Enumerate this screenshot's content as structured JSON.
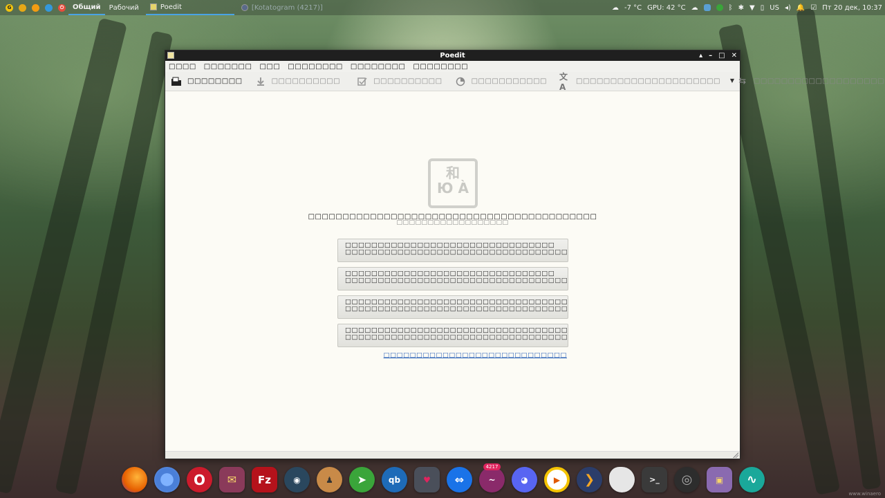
{
  "top_panel": {
    "workspace_1": "Общий",
    "workspace_2": "Рабочий",
    "tasks": [
      {
        "label": "Poedit",
        "active": true
      },
      {
        "label": "[Kotatogram (4217)]",
        "active": false
      }
    ],
    "weather": "-7 °C",
    "gpu": "GPU: 42 °C",
    "keyboard_layout": "US",
    "clock": "Пт 20 дек, 10:37"
  },
  "window": {
    "title": "Poedit",
    "controls": [
      "▴",
      "–",
      "□",
      "✕"
    ],
    "menu": [
      "□□□□",
      "□□□□□□□",
      "□□□",
      "□□□□□□□□",
      "□□□□□□□□",
      "□□□□□□□□"
    ],
    "toolbar": [
      {
        "label": "□□□□□□□□",
        "icon": "open-file-icon",
        "enabled": true
      },
      {
        "label": "□□□□□□□□□□",
        "icon": "download-icon",
        "enabled": false
      },
      {
        "label": "□□□□□□□□□□",
        "icon": "validate-icon",
        "enabled": false
      },
      {
        "label": "□□□□□□□□□□□",
        "icon": "pie-icon",
        "enabled": false
      },
      {
        "label": "□□□□□□□□□□□□□□□□□□□□□",
        "icon": "translate-icon",
        "enabled": false
      },
      {
        "label": "□□□□□□□□□□□□□□□□□□□□□",
        "icon": "sync-icon",
        "enabled": false
      }
    ]
  },
  "welcome": {
    "logo_line1": "和",
    "logo_line2": "Ю À",
    "title": "□□□□□□□□□□□□□□□□□□□□□□□□□□□□□□□□□□□□□□□□□□",
    "subtitle": "□□□□□□□□□□□□□□□□□□",
    "actions": [
      {
        "title": "□□□□□□□□□□□□□□□□□□□□□□□□□□□□□□□□",
        "desc": "□□□□□□□□□□□□□□□□□□□□□□□□□□□□□□□□□□□□□□□□□□□□□□□□□□□□□□□□□□□□□□□□□□□□□"
      },
      {
        "title": "□□□□□□□□□□□□□□□□□□□□□□□□□□□□□□□□",
        "desc": "□□□□□□□□□□□□□□□□□□□□□□□□□□□□□□□□□□□□□□□□□□□□□□□□□□□□□□□□□□□□□□□□□□□□□□□□□□□□□□□□□□□"
      },
      {
        "title": "□□□□□□□□□□□□□□□□□□□□□□□□□□□□□□□□□□□□□□□□□□□□□□□□□□□□□□",
        "desc": "□□□□□□□□□□□□□□□□□□□□□□□□□□□□□□□□□□□□□□□□□□□□□□□□□□□□□□□□□□□□□□□□□□□□□□□□□□□□□□□□□□□"
      },
      {
        "title": "□□□□□□□□□□□□□□□□□□□□□□□□□□□□□□□□□□□□□□□□□□□□□□□□□□□□□□□□□□□□□□□□□□□□□□□",
        "desc": "□□□□□□□□□□□□□□□□□□□□□□□□□□□□□□□□□□□□□□□□□□□□□□□□□□□□□□□□□□□□□□□□□□□□□□□□□□□□□□□□□□□"
      }
    ],
    "link": "□□□□□□□□□□□□□□□□□□□□□□□□□□□□"
  },
  "dock": [
    {
      "name": "firefox",
      "color": "#e66000",
      "glyph": ""
    },
    {
      "name": "chrome",
      "color": "#5b8ee6",
      "glyph": ""
    },
    {
      "name": "opera",
      "color": "#cc1b2c",
      "glyph": "O"
    },
    {
      "name": "mail",
      "color": "#8a3a5a",
      "glyph": "✉"
    },
    {
      "name": "filezilla",
      "color": "#b5121b",
      "glyph": "Fz"
    },
    {
      "name": "steam",
      "color": "#2a475e",
      "glyph": "◉"
    },
    {
      "name": "game",
      "color": "#c88a48",
      "glyph": "♟"
    },
    {
      "name": "telegram",
      "color": "#3aa53a",
      "glyph": "➤"
    },
    {
      "name": "qbittorrent",
      "color": "#1e6bb8",
      "glyph": "qb"
    },
    {
      "name": "shield",
      "color": "#4a4f5a",
      "glyph": "♥"
    },
    {
      "name": "teamviewer",
      "color": "#1a73e8",
      "glyph": "⇔"
    },
    {
      "name": "kotatogram",
      "color": "#8a2a6a",
      "glyph": "~",
      "badge": "4217"
    },
    {
      "name": "discord",
      "color": "#5865f2",
      "glyph": "◕"
    },
    {
      "name": "player",
      "color": "#f5c400",
      "glyph": "▶"
    },
    {
      "name": "terminal-alt",
      "color": "#2b3d6a",
      "glyph": "❯"
    },
    {
      "name": "disk",
      "color": "#e6e6e6",
      "glyph": ""
    },
    {
      "name": "terminal",
      "color": "#3a3a3a",
      "glyph": ">_"
    },
    {
      "name": "settings",
      "color": "#2d2d2d",
      "glyph": "◎"
    },
    {
      "name": "screenshot",
      "color": "#8a6ab0",
      "glyph": "▣"
    },
    {
      "name": "monitor",
      "color": "#1aa89a",
      "glyph": "∿"
    }
  ],
  "watermark": "www.winaero"
}
